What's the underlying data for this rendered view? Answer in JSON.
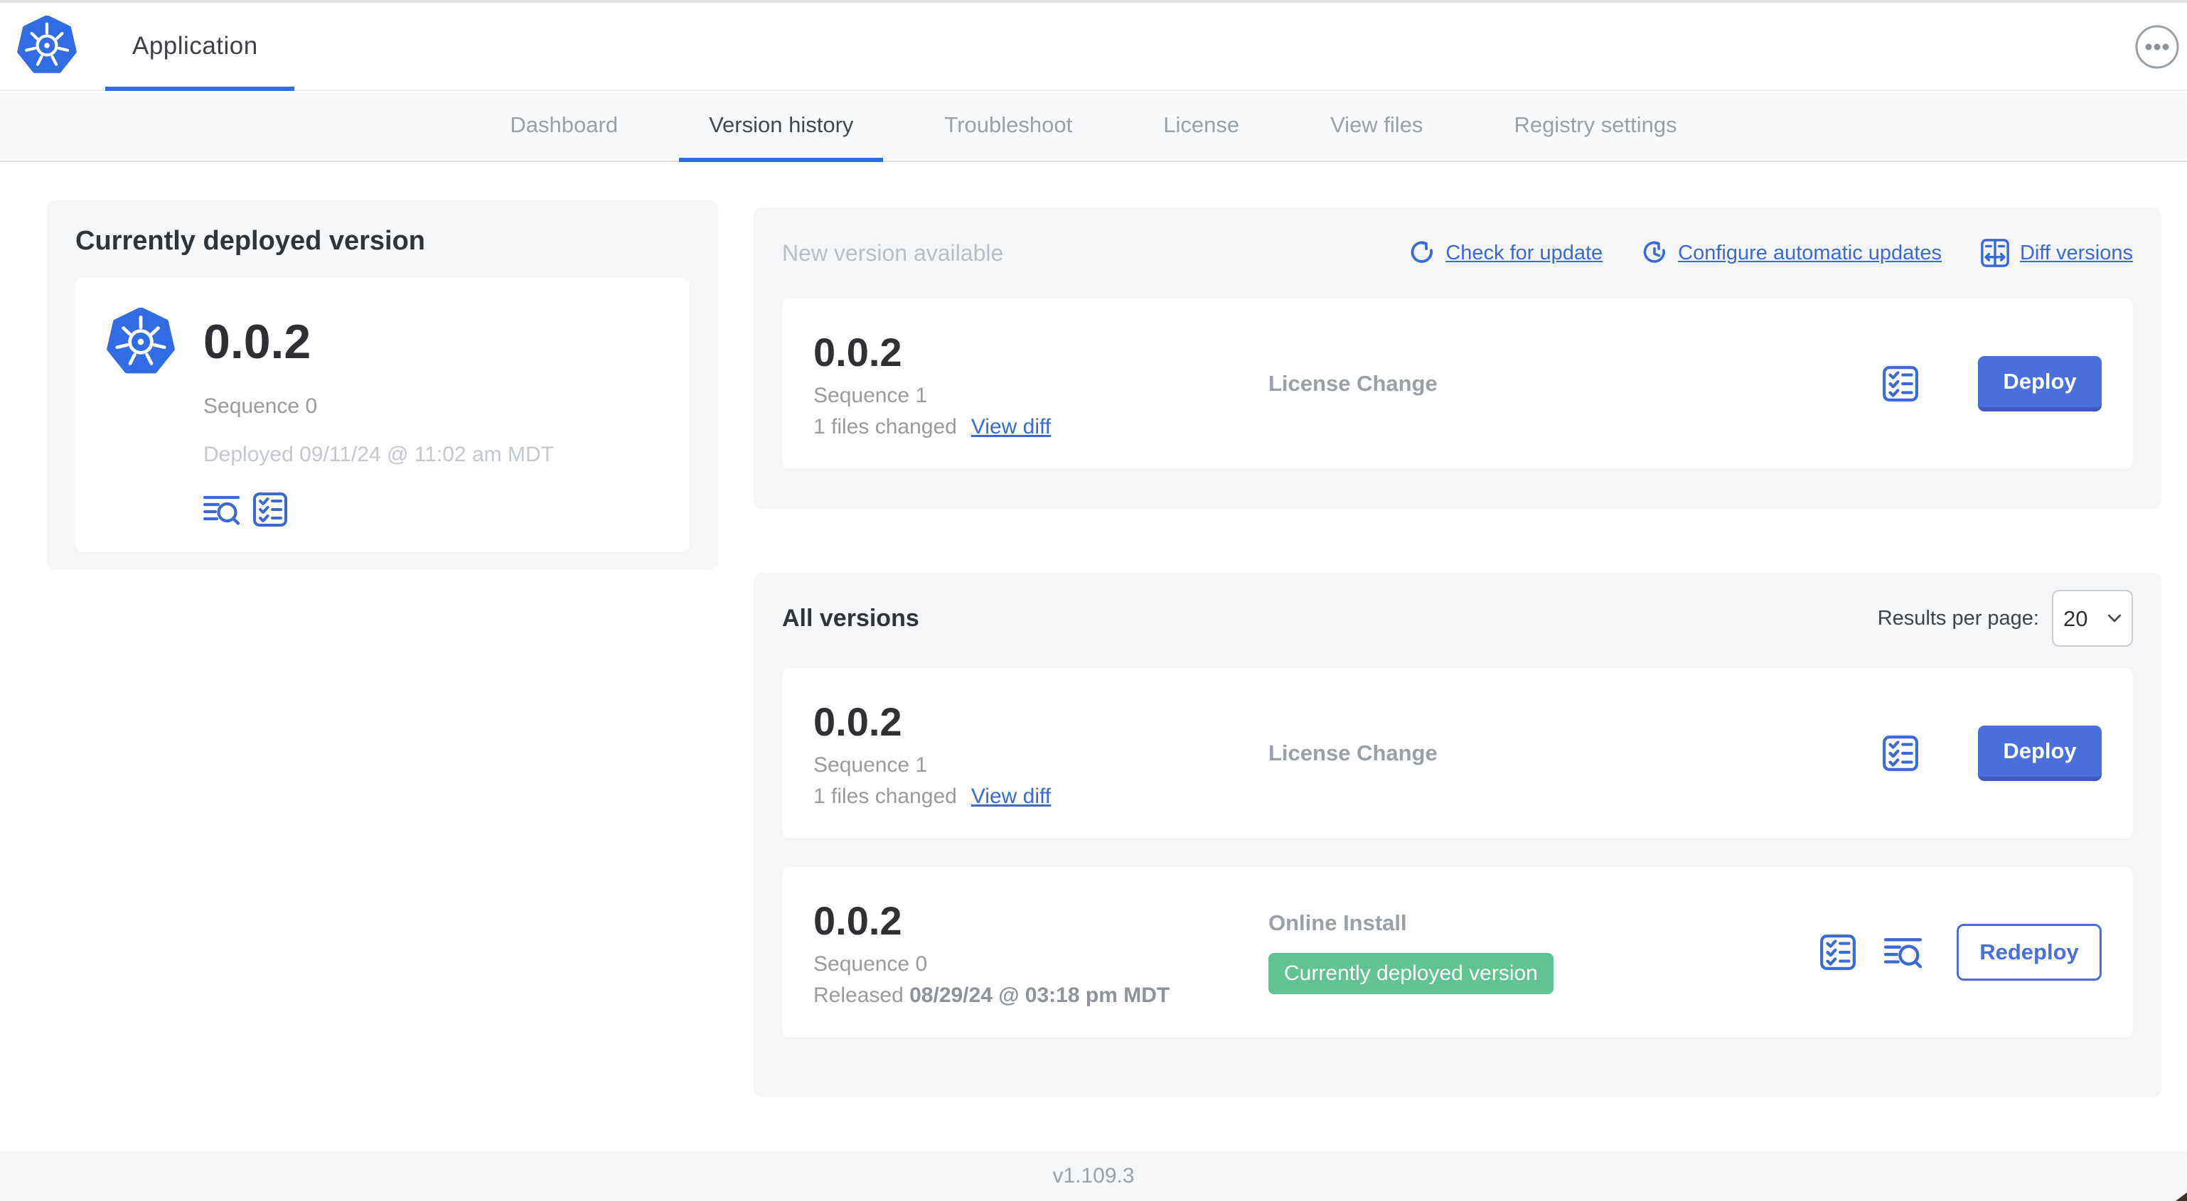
{
  "header": {
    "app_title": "Application"
  },
  "nav_tabs": {
    "items": [
      {
        "label": "Dashboard"
      },
      {
        "label": "Version history"
      },
      {
        "label": "Troubleshoot"
      },
      {
        "label": "License"
      },
      {
        "label": "View files"
      },
      {
        "label": "Registry settings"
      }
    ],
    "active": "Version history"
  },
  "current_version": {
    "title": "Currently deployed version",
    "version": "0.0.2",
    "sequence": "Sequence 0",
    "deployed": "Deployed 09/11/24 @ 11:02 am MDT"
  },
  "new_version": {
    "title": "New version available",
    "actions": {
      "check": "Check for update",
      "configure": "Configure automatic updates",
      "diff": "Diff versions"
    },
    "row": {
      "version": "0.0.2",
      "sequence": "Sequence 1",
      "files_changed": "1 files changed",
      "view_diff": "View diff",
      "source": "License Change",
      "deploy": "Deploy"
    }
  },
  "all_versions": {
    "title": "All versions",
    "results_label": "Results per page:",
    "results_value": "20",
    "row1": {
      "version": "0.0.2",
      "sequence": "Sequence 1",
      "files_changed": "1 files changed",
      "view_diff": "View diff",
      "source": "License Change",
      "deploy": "Deploy"
    },
    "row2": {
      "version": "0.0.2",
      "sequence": "Sequence 0",
      "released_prefix": "Released",
      "released_date": "08/29/24 @ 03:18 pm MDT",
      "source": "Online Install",
      "badge": "Currently deployed version",
      "deploy": "Redeploy"
    }
  },
  "footer": {
    "app_version": "v1.109.3"
  },
  "colors": {
    "accent_blue": "#3b6ad4",
    "kubernetes_blue": "#326ce5",
    "button_blue": "#4a6fdd",
    "active_tab_blue": "#326de6",
    "badge_green": "#62c392",
    "panel_bg": "#f5f6f8"
  }
}
